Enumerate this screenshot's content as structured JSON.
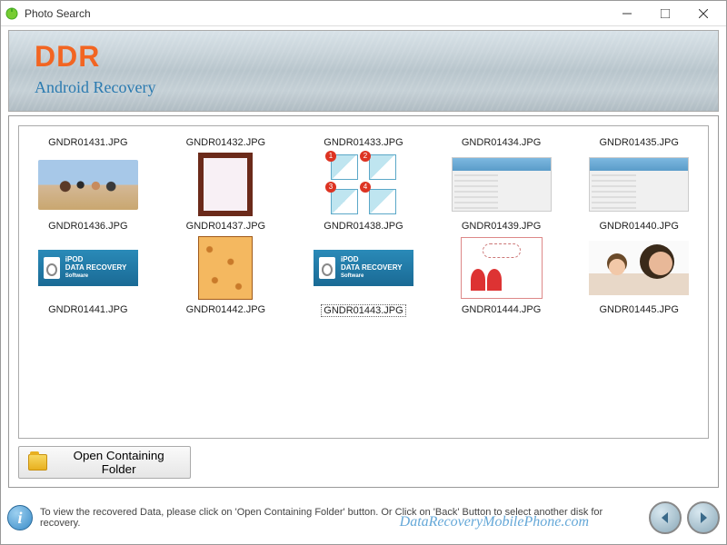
{
  "window": {
    "title": "Photo Search"
  },
  "header": {
    "brand": "DDR",
    "subtitle": "Android Recovery"
  },
  "thumbnails": {
    "row1": [
      {
        "label": "GNDR01431.JPG"
      },
      {
        "label": "GNDR01432.JPG"
      },
      {
        "label": "GNDR01433.JPG"
      },
      {
        "label": "GNDR01434.JPG"
      },
      {
        "label": "GNDR01435.JPG"
      }
    ],
    "row2": [
      {
        "label": "GNDR01436.JPG"
      },
      {
        "label": "GNDR01437.JPG"
      },
      {
        "label": "GNDR01438.JPG"
      },
      {
        "label": "GNDR01439.JPG"
      },
      {
        "label": "GNDR01440.JPG"
      }
    ],
    "row3": [
      {
        "label": "GNDR01441.JPG"
      },
      {
        "label": "GNDR01442.JPG"
      },
      {
        "label": "GNDR01443.JPG",
        "selected": true
      },
      {
        "label": "GNDR01444.JPG"
      },
      {
        "label": "GNDR01445.JPG"
      }
    ]
  },
  "buttons": {
    "open_folder": "Open Containing Folder"
  },
  "footer": {
    "info_text": "To view the recovered Data, please click on 'Open Containing Folder' button. Or Click on 'Back' Button to select another disk for recovery.",
    "watermark": "DataRecoveryMobilePhone.com"
  }
}
